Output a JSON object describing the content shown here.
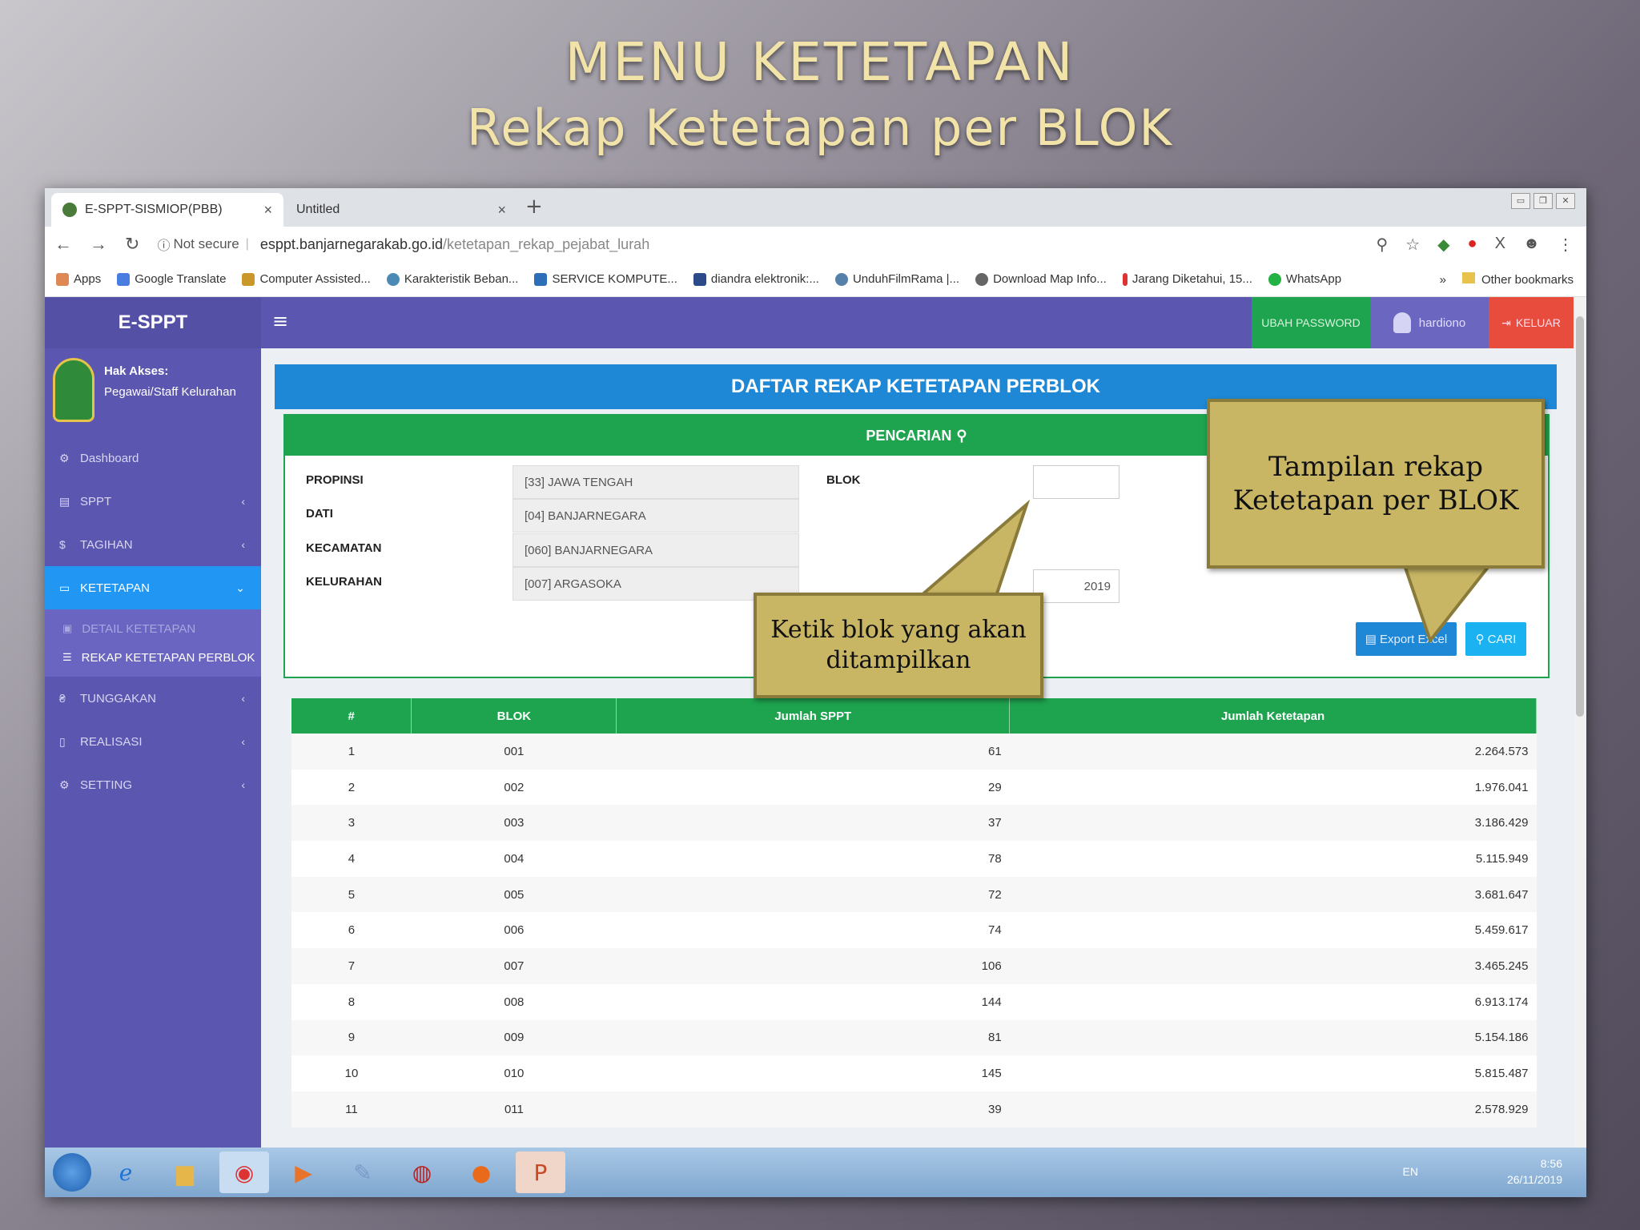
{
  "slide": {
    "title_line1": "MENU KETETAPAN",
    "title_line2": "Rekap Ketetapan per BLOK"
  },
  "browser": {
    "tabs": [
      {
        "label": "E-SPPT-SISMIOP(PBB)",
        "active": true
      },
      {
        "label": "Untitled",
        "active": false
      }
    ],
    "new_tab": "+",
    "not_secure": "Not secure",
    "url_host": "esppt.banjarnegarakab.go.id",
    "url_path": "/ketetapan_rekap_pejabat_lurah",
    "bookmarks": [
      "Apps",
      "Google Translate",
      "Computer Assisted...",
      "Karakteristik Beban...",
      "SERVICE KOMPUTE...",
      "diandra elektronik:...",
      "UnduhFilmRama |...",
      "Download Map Info...",
      "Jarang Diketahui, 15...",
      "WhatsApp"
    ],
    "more": "»",
    "other_bookmarks": "Other bookmarks"
  },
  "app": {
    "brand": "E-SPPT",
    "access_label": "Hak Akses:",
    "access_role": "Pegawai/Staff Kelurahan",
    "menu": [
      {
        "label": "Dashboard",
        "icon": "dashboard-icon"
      },
      {
        "label": "SPPT",
        "icon": "document-icon"
      },
      {
        "label": "TAGIHAN",
        "icon": "money-icon"
      },
      {
        "label": "KETETAPAN",
        "icon": "monitor-icon"
      },
      {
        "label": "TUNGGAKAN",
        "icon": "debt-icon"
      },
      {
        "label": "REALISASI",
        "icon": "file-icon"
      },
      {
        "label": "SETTING",
        "icon": "gear-icon"
      }
    ],
    "submenu": [
      {
        "label": "DETAIL KETETAPAN"
      },
      {
        "label": "REKAP KETETAPAN PERBLOK"
      }
    ],
    "topnav": {
      "ubah_password": "UBAH PASSWORD",
      "user": "hardiono",
      "keluar": "KELUAR"
    },
    "panel_title": "DAFTAR REKAP KETETAPAN PERBLOK",
    "search": {
      "title": "PENCARIAN",
      "propinsi_label": "PROPINSI",
      "propinsi_value": "[33] JAWA TENGAH",
      "dati_label": "DATI",
      "dati_value": "[04] BANJARNEGARA",
      "kecamatan_label": "KECAMATAN",
      "kecamatan_value": "[060] BANJARNEGARA",
      "kelurahan_label": "KELURAHAN",
      "kelurahan_value": "[007] ARGASOKA",
      "blok_label": "BLOK",
      "blok_value": "",
      "tahun_value": "2019",
      "export_button": "Export Excel",
      "cari_button": "CARI"
    },
    "table": {
      "headers": [
        "#",
        "BLOK",
        "Jumlah SPPT",
        "Jumlah Ketetapan"
      ],
      "rows": [
        [
          "1",
          "001",
          "61",
          "2.264.573"
        ],
        [
          "2",
          "002",
          "29",
          "1.976.041"
        ],
        [
          "3",
          "003",
          "37",
          "3.186.429"
        ],
        [
          "4",
          "004",
          "78",
          "5.115.949"
        ],
        [
          "5",
          "005",
          "72",
          "3.681.647"
        ],
        [
          "6",
          "006",
          "74",
          "5.459.617"
        ],
        [
          "7",
          "007",
          "106",
          "3.465.245"
        ],
        [
          "8",
          "008",
          "144",
          "6.913.174"
        ],
        [
          "9",
          "009",
          "81",
          "5.154.186"
        ],
        [
          "10",
          "010",
          "145",
          "5.815.487"
        ],
        [
          "11",
          "011",
          "39",
          "2.578.929"
        ]
      ]
    }
  },
  "taskbar": {
    "lang": "EN",
    "time": "8:56",
    "date": "26/11/2019"
  },
  "callouts": {
    "blok_hint": "Ketik blok yang akan ditampilkan",
    "rekap_hint": "Tampilan rekap Ketetapan per BLOK"
  },
  "colors": {
    "sidebar": "#5b56b0",
    "header_blue": "#1e88d6",
    "green": "#1ea34f",
    "danger": "#e84c3d",
    "callout": "#c8b664"
  }
}
